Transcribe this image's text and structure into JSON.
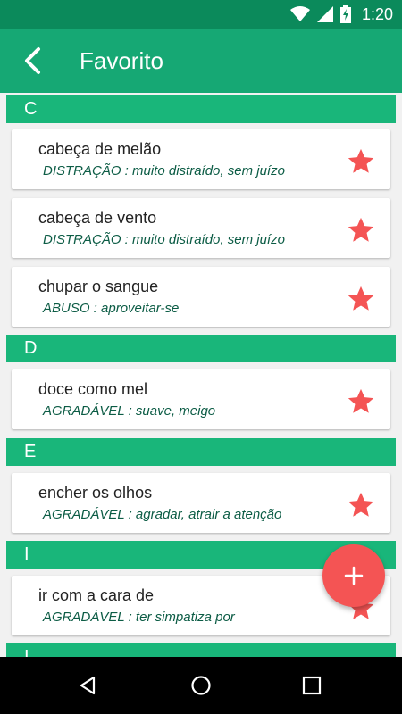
{
  "status_bar": {
    "time": "1:20",
    "icons": [
      "wifi-icon",
      "signal-icon",
      "battery-charging-icon"
    ]
  },
  "app_bar": {
    "title": "Favorito",
    "back_icon": "back-arrow-icon"
  },
  "colors": {
    "status_bar": "#0b8a5b",
    "app_bar": "#16a874",
    "section_header": "#19b67a",
    "star": "#f45454",
    "fab": "#f45454"
  },
  "sections": [
    {
      "letter": "C"
    },
    {
      "letter": "D"
    },
    {
      "letter": "E"
    },
    {
      "letter": "I"
    },
    {
      "letter": "I"
    }
  ],
  "items": [
    {
      "title": "cabeça de melão",
      "subtitle": "DISTRAÇÃO : muito distraído, sem juízo"
    },
    {
      "title": "cabeça de vento",
      "subtitle": "DISTRAÇÃO : muito distraído, sem juízo"
    },
    {
      "title": "chupar o sangue",
      "subtitle": "ABUSO : aproveitar-se"
    },
    {
      "title": "doce como mel",
      "subtitle": "AGRADÁVEL : suave, meigo"
    },
    {
      "title": "encher os olhos",
      "subtitle": "AGRADÁVEL : agradar, atrair a atenção"
    },
    {
      "title": "ir com a cara de",
      "subtitle": "AGRADÁVEL : ter simpatiza por"
    }
  ],
  "fab": {
    "icon": "plus-icon"
  },
  "nav_bar": {
    "icons": [
      "back-triangle-icon",
      "home-circle-icon",
      "recents-square-icon"
    ]
  }
}
